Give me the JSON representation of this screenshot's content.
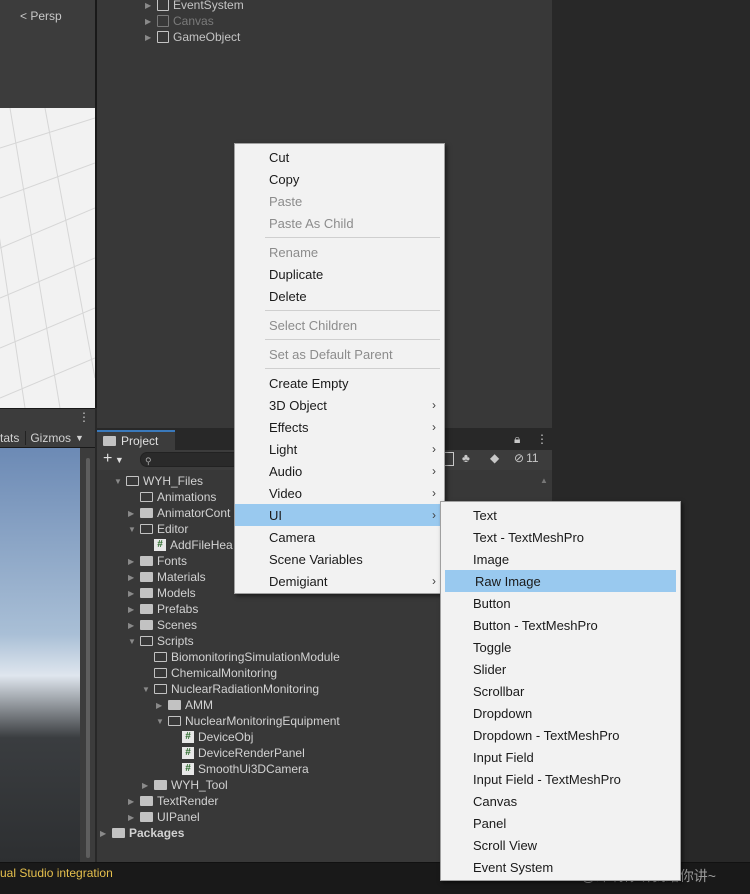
{
  "scene": {
    "persp_label": "Persp"
  },
  "hierarchy": {
    "items": [
      {
        "label": "EventSystem",
        "dim": false
      },
      {
        "label": "Canvas",
        "dim": true
      },
      {
        "label": "GameObject",
        "dim": false
      }
    ]
  },
  "game": {
    "stats_label": "tats",
    "gizmos_label": "Gizmos"
  },
  "project": {
    "tab_label": "Project",
    "hidden_count": "11",
    "tree": [
      {
        "label": "WYH_Files",
        "depth": 0,
        "kind": "folder-open",
        "expanded": true
      },
      {
        "label": "Animations",
        "depth": 1,
        "kind": "folder-empty"
      },
      {
        "label": "AnimatorCont",
        "depth": 1,
        "kind": "folder"
      },
      {
        "label": "Editor",
        "depth": 1,
        "kind": "folder-open",
        "expanded": true
      },
      {
        "label": "AddFileHea",
        "depth": 2,
        "kind": "script"
      },
      {
        "label": "Fonts",
        "depth": 1,
        "kind": "folder"
      },
      {
        "label": "Materials",
        "depth": 1,
        "kind": "folder"
      },
      {
        "label": "Models",
        "depth": 1,
        "kind": "folder"
      },
      {
        "label": "Prefabs",
        "depth": 1,
        "kind": "folder"
      },
      {
        "label": "Scenes",
        "depth": 1,
        "kind": "folder"
      },
      {
        "label": "Scripts",
        "depth": 1,
        "kind": "folder-open",
        "expanded": true
      },
      {
        "label": "BiomonitoringSimulationModule",
        "depth": 2,
        "kind": "folder-empty"
      },
      {
        "label": "ChemicalMonitoring",
        "depth": 2,
        "kind": "folder-empty"
      },
      {
        "label": "NuclearRadiationMonitoring",
        "depth": 2,
        "kind": "folder-open",
        "expanded": true
      },
      {
        "label": "AMM",
        "depth": 3,
        "kind": "folder"
      },
      {
        "label": "NuclearMonitoringEquipment",
        "depth": 3,
        "kind": "folder-open",
        "expanded": true
      },
      {
        "label": "DeviceObj",
        "depth": 4,
        "kind": "script"
      },
      {
        "label": "DeviceRenderPanel",
        "depth": 4,
        "kind": "script"
      },
      {
        "label": "SmoothUi3DCamera",
        "depth": 4,
        "kind": "script"
      },
      {
        "label": "WYH_Tool",
        "depth": 2,
        "kind": "folder"
      },
      {
        "label": "TextRender",
        "depth": 1,
        "kind": "folder"
      },
      {
        "label": "UIPanel",
        "depth": 1,
        "kind": "folder"
      },
      {
        "label": "Packages",
        "depth": 0,
        "kind": "folder",
        "bold": true
      }
    ]
  },
  "context_menu": {
    "items": [
      {
        "label": "Cut",
        "disabled": false
      },
      {
        "label": "Copy",
        "disabled": false
      },
      {
        "label": "Paste",
        "disabled": true
      },
      {
        "label": "Paste As Child",
        "disabled": true
      },
      {
        "separator": true
      },
      {
        "label": "Rename",
        "disabled": true
      },
      {
        "label": "Duplicate",
        "disabled": false
      },
      {
        "label": "Delete",
        "disabled": false
      },
      {
        "separator": true
      },
      {
        "label": "Select Children",
        "disabled": true
      },
      {
        "separator": true
      },
      {
        "label": "Set as Default Parent",
        "disabled": true
      },
      {
        "separator": true
      },
      {
        "label": "Create Empty",
        "disabled": false
      },
      {
        "label": "3D Object",
        "disabled": false,
        "submenu": true
      },
      {
        "label": "Effects",
        "disabled": false,
        "submenu": true
      },
      {
        "label": "Light",
        "disabled": false,
        "submenu": true
      },
      {
        "label": "Audio",
        "disabled": false,
        "submenu": true
      },
      {
        "label": "Video",
        "disabled": false,
        "submenu": true
      },
      {
        "label": "UI",
        "disabled": false,
        "submenu": true,
        "highlighted": true
      },
      {
        "label": "Camera",
        "disabled": false
      },
      {
        "label": "Scene Variables",
        "disabled": false
      },
      {
        "label": "Demigiant",
        "disabled": false,
        "submenu": true
      }
    ]
  },
  "ui_submenu": {
    "items": [
      {
        "label": "Text"
      },
      {
        "label": "Text - TextMeshPro"
      },
      {
        "label": "Image"
      },
      {
        "label": "Raw Image",
        "highlighted": true
      },
      {
        "label": "Button"
      },
      {
        "label": "Button - TextMeshPro"
      },
      {
        "label": "Toggle"
      },
      {
        "label": "Slider"
      },
      {
        "label": "Scrollbar"
      },
      {
        "label": "Dropdown"
      },
      {
        "label": "Dropdown - TextMeshPro"
      },
      {
        "label": "Input Field"
      },
      {
        "label": "Input Field - TextMeshPro"
      },
      {
        "label": "Canvas"
      },
      {
        "label": "Panel"
      },
      {
        "label": "Scroll View"
      },
      {
        "label": "Event System"
      }
    ]
  },
  "status_bar": {
    "text": "ual Studio integration"
  },
  "watermark": "CSDN @郎啊你听我给你讲~",
  "colors": {
    "highlight": "#99c9ef",
    "menu_bg": "#f2f2f2",
    "editor_bg": "#383838",
    "status_text": "#e6c04d"
  }
}
